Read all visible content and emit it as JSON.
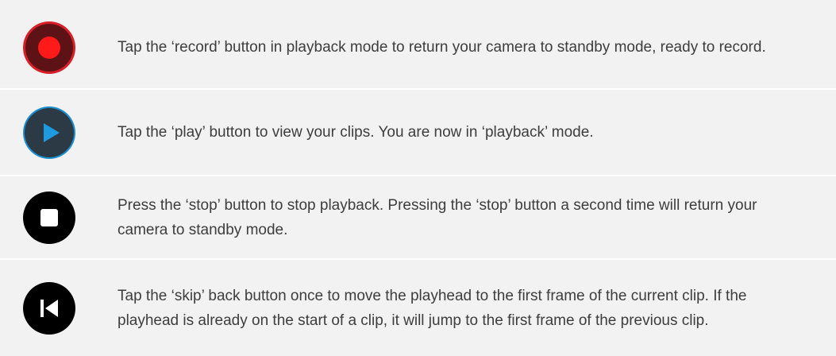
{
  "rows": [
    {
      "icon": "record-icon",
      "text": "Tap the ‘record’ button in playback mode to return your camera to standby mode, ready to record."
    },
    {
      "icon": "play-icon",
      "text": "Tap the ‘play’ button to view your clips. You are now in ‘playback’ mode."
    },
    {
      "icon": "stop-icon",
      "text": "Press the ‘stop’ button to stop playback. Pressing the ‘stop’ button a second time will return your camera to standby mode."
    },
    {
      "icon": "skip-back-icon",
      "text": "Tap the ‘skip’ back button once to move the playhead to the first frame of the current clip. If the playhead is already on the start of a clip, it will jump to the first frame of the previous clip."
    }
  ],
  "colors": {
    "record_outer": "#e0202a",
    "record_ring": "#6a1318",
    "record_dot": "#ff1a1a",
    "play_bg": "#2c3a46",
    "play_ring": "#1a8fd0",
    "play_triangle": "#1e9be0",
    "stop_bg": "#000000",
    "skip_bg": "#000000"
  }
}
